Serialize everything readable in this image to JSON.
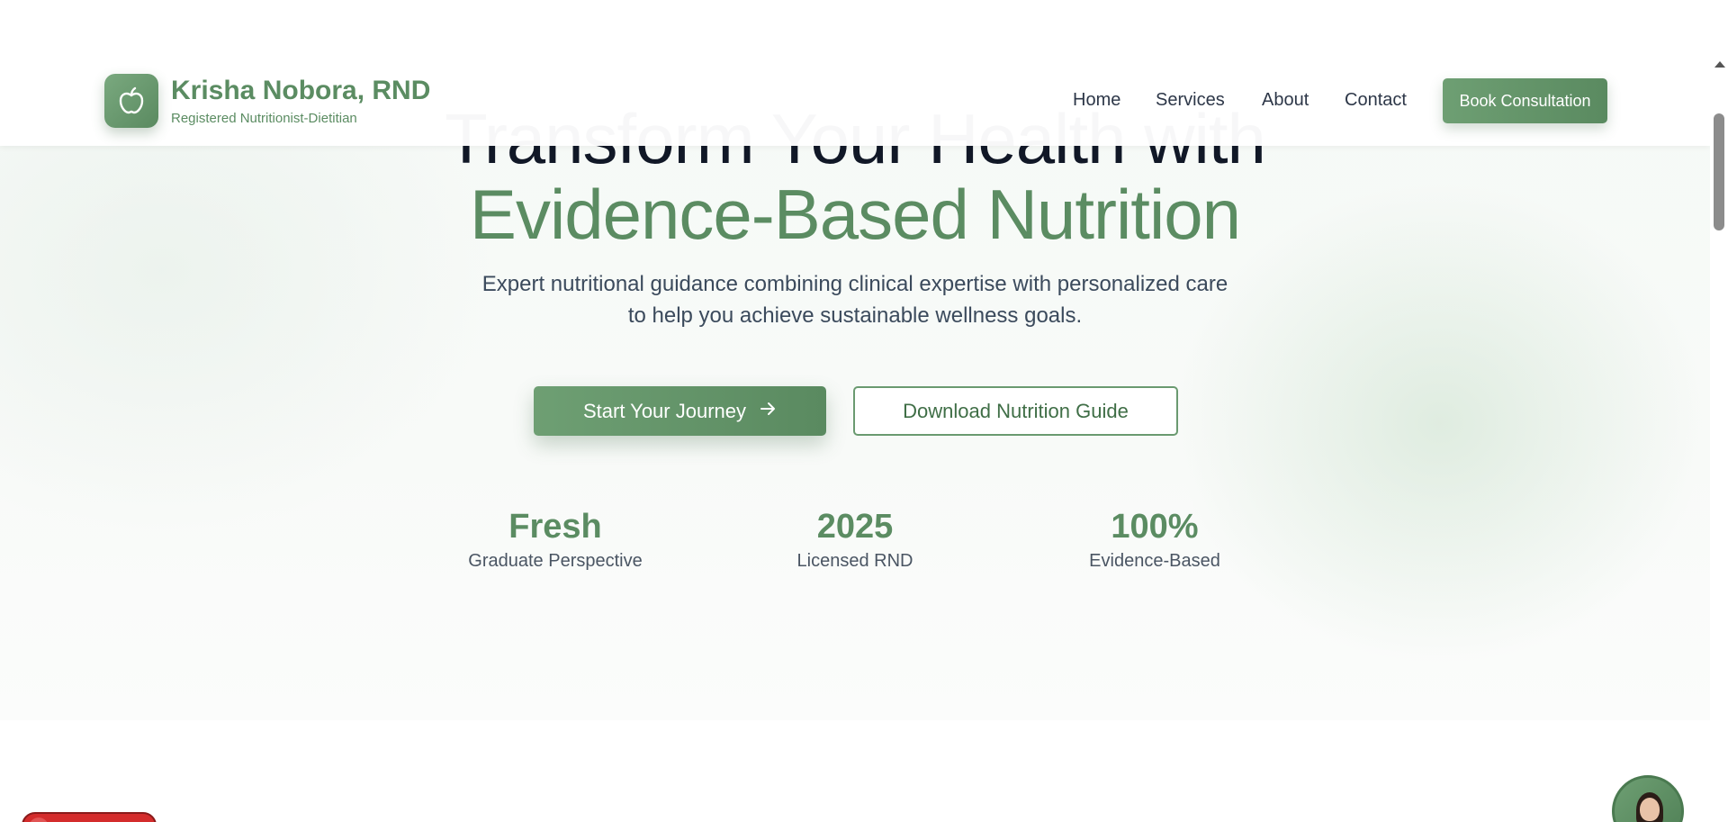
{
  "header": {
    "brand_name": "Krisha Nobora, RND",
    "brand_tagline": "Registered Nutritionist-Dietitian",
    "logo_icon": "apple-icon",
    "nav": [
      "Home",
      "Services",
      "About",
      "Contact"
    ],
    "cta_label": "Book Consultation"
  },
  "hero": {
    "title_line1": "Transform Your Health with",
    "title_line2": "Evidence-Based Nutrition",
    "subtitle": "Expert nutritional guidance combining clinical expertise with personalized care to help you achieve sustainable wellness goals.",
    "primary_button": "Start Your Journey",
    "primary_button_icon": "arrow-right-icon",
    "secondary_button": "Download Nutrition Guide"
  },
  "stats": [
    {
      "value": "Fresh",
      "label": "Graduate Perspective"
    },
    {
      "value": "2025",
      "label": "Licensed RND"
    },
    {
      "value": "100%",
      "label": "Evidence-Based"
    }
  ],
  "colors": {
    "brand_green": "#5b8c62",
    "heading_dark": "#111827",
    "text_body": "#3b4a5c"
  }
}
